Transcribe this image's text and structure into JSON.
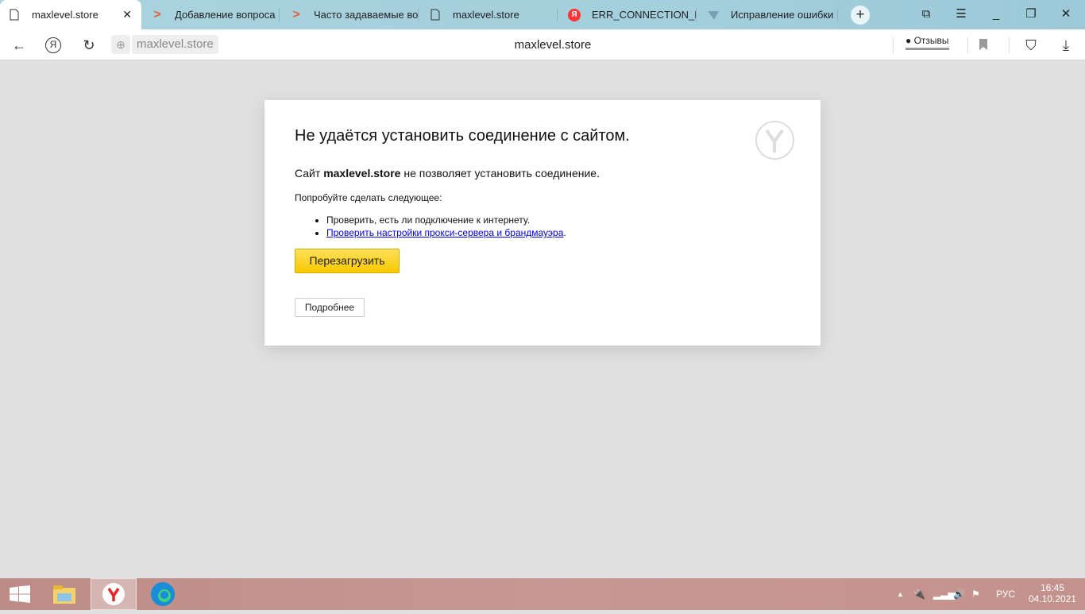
{
  "tabs": [
    {
      "label": "maxlevel.store",
      "icon": "page-icon",
      "active": true
    },
    {
      "label": "Добавление вопроса",
      "icon": "chevron-icon"
    },
    {
      "label": "Часто задаваемые вопросы",
      "icon": "chevron-icon"
    },
    {
      "label": "maxlevel.store",
      "icon": "page-icon"
    },
    {
      "label": "ERR_CONNECTION_REFUSED",
      "icon": "yandex-icon"
    },
    {
      "label": "Исправление ошибки",
      "icon": "site-icon"
    }
  ],
  "toolbar": {
    "url": "maxlevel.store",
    "page_title": "maxlevel.store",
    "reviews_label": "Отзывы",
    "yandex_letter": "Я"
  },
  "error": {
    "title": "Не удаётся установить соединение с сайтом.",
    "site_prefix": "Сайт ",
    "site_name": "maxlevel.store",
    "site_suffix": " не позволяет установить соединение.",
    "try_label": "Попробуйте сделать следующее:",
    "suggestion1": "Проверить, есть ли подключение к интернету.",
    "suggestion2_link": "Проверить настройки прокси-сервера и брандмауэра",
    "suggestion2_suffix": ".",
    "reload_button": "Перезагрузить",
    "details_button": "Подробнее"
  },
  "taskbar": {
    "language": "РУС",
    "time": "16:45",
    "date": "04.10.2021"
  }
}
